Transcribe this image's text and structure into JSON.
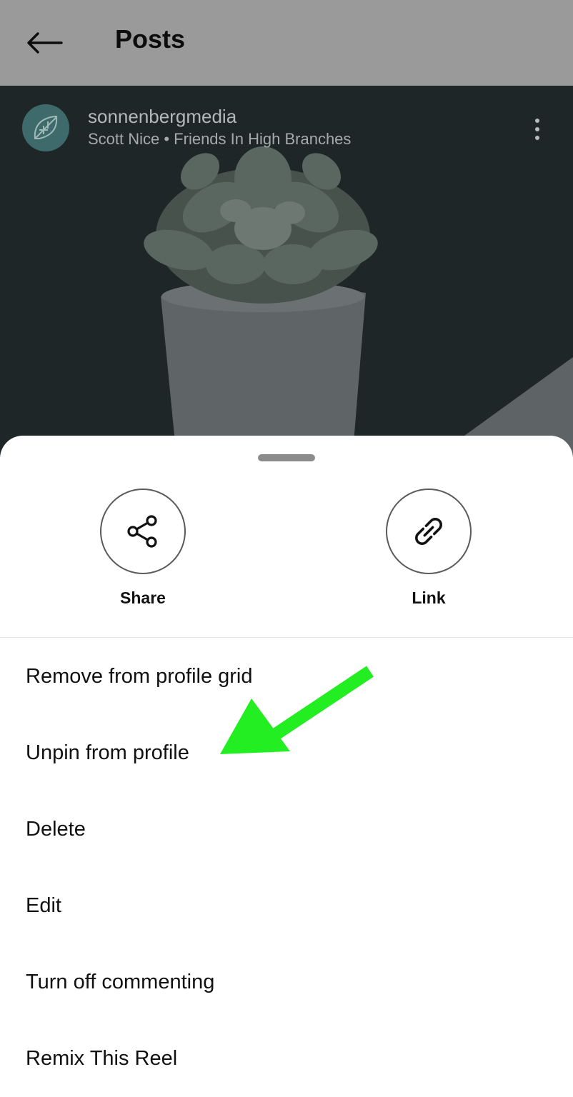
{
  "header": {
    "title": "Posts",
    "back_icon": "arrow-left-icon"
  },
  "post": {
    "username": "sonnenbergmedia",
    "subtitle": "Scott Nice • Friends In High Branches",
    "avatar_icon": "leaf-logo-icon",
    "more_icon": "more-vertical-icon"
  },
  "sheet": {
    "actions": [
      {
        "label": "Share",
        "icon": "share-icon"
      },
      {
        "label": "Link",
        "icon": "link-icon"
      }
    ],
    "menu": [
      {
        "label": "Remove from profile grid"
      },
      {
        "label": "Unpin from profile"
      },
      {
        "label": "Delete"
      },
      {
        "label": "Edit"
      },
      {
        "label": "Turn off commenting"
      },
      {
        "label": "Remix This Reel"
      }
    ]
  },
  "annotation": {
    "arrow_color": "#22ee22",
    "points_to": "Unpin from profile"
  },
  "colors": {
    "scrim_bar": "#9a9a9a",
    "post_background": "#1f2628",
    "sheet": "#ffffff"
  }
}
